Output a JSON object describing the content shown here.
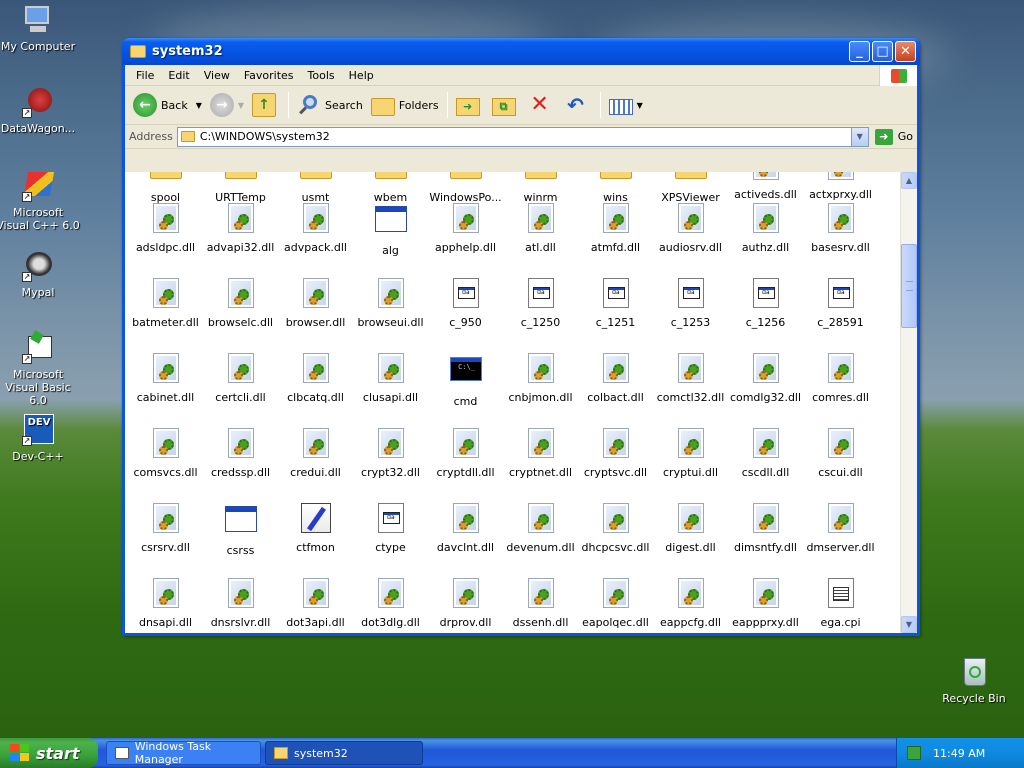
{
  "desktop": {
    "icons": [
      {
        "label": "My Computer",
        "icon": "computer-icon"
      },
      {
        "label": "DataWagon...",
        "icon": "datawagon-icon"
      },
      {
        "label": "Microsoft Visual C++ 6.0",
        "icon": "visual-cpp-icon"
      },
      {
        "label": "Mypal",
        "icon": "mypal-icon"
      },
      {
        "label": "Microsoft Visual Basic 6.0",
        "icon": "visual-basic-icon"
      },
      {
        "label": "Dev-C++",
        "icon": "devcpp-icon"
      },
      {
        "label": "Recycle Bin",
        "icon": "recycle-bin-icon"
      }
    ]
  },
  "window": {
    "title": "system32",
    "menu": [
      "File",
      "Edit",
      "View",
      "Favorites",
      "Tools",
      "Help"
    ],
    "toolbar": {
      "back_label": "Back",
      "search_label": "Search",
      "folders_label": "Folders"
    },
    "address": {
      "label": "Address",
      "value": "C:\\WINDOWS\\system32",
      "go_label": "Go"
    },
    "files": [
      {
        "name": "spool",
        "type": "folder"
      },
      {
        "name": "URTTemp",
        "type": "folder"
      },
      {
        "name": "usmt",
        "type": "folder"
      },
      {
        "name": "wbem",
        "type": "folder"
      },
      {
        "name": "WindowsPo...",
        "type": "folder"
      },
      {
        "name": "winrm",
        "type": "folder"
      },
      {
        "name": "wins",
        "type": "folder"
      },
      {
        "name": "XPSViewer",
        "type": "folder"
      },
      {
        "name": "activeds.dll",
        "type": "dll"
      },
      {
        "name": "actxprxy.dll",
        "type": "dll"
      },
      {
        "name": "adsldpc.dll",
        "type": "dll"
      },
      {
        "name": "advapi32.dll",
        "type": "dll"
      },
      {
        "name": "advpack.dll",
        "type": "dll"
      },
      {
        "name": "alg",
        "type": "exe"
      },
      {
        "name": "apphelp.dll",
        "type": "dll"
      },
      {
        "name": "atl.dll",
        "type": "dll"
      },
      {
        "name": "atmfd.dll",
        "type": "dll"
      },
      {
        "name": "audiosrv.dll",
        "type": "dll"
      },
      {
        "name": "authz.dll",
        "type": "dll"
      },
      {
        "name": "basesrv.dll",
        "type": "dll"
      },
      {
        "name": "batmeter.dll",
        "type": "dll"
      },
      {
        "name": "browselc.dll",
        "type": "dll"
      },
      {
        "name": "browser.dll",
        "type": "dll"
      },
      {
        "name": "browseui.dll",
        "type": "dll"
      },
      {
        "name": "c_950",
        "type": "nls"
      },
      {
        "name": "c_1250",
        "type": "nls"
      },
      {
        "name": "c_1251",
        "type": "nls"
      },
      {
        "name": "c_1253",
        "type": "nls"
      },
      {
        "name": "c_1256",
        "type": "nls"
      },
      {
        "name": "c_28591",
        "type": "nls"
      },
      {
        "name": "cabinet.dll",
        "type": "dll"
      },
      {
        "name": "certcli.dll",
        "type": "dll"
      },
      {
        "name": "clbcatq.dll",
        "type": "dll"
      },
      {
        "name": "clusapi.dll",
        "type": "dll"
      },
      {
        "name": "cmd",
        "type": "cmd"
      },
      {
        "name": "cnbjmon.dll",
        "type": "dll"
      },
      {
        "name": "colbact.dll",
        "type": "dll"
      },
      {
        "name": "comctl32.dll",
        "type": "dll"
      },
      {
        "name": "comdlg32.dll",
        "type": "dll"
      },
      {
        "name": "comres.dll",
        "type": "dll"
      },
      {
        "name": "comsvcs.dll",
        "type": "dll"
      },
      {
        "name": "credssp.dll",
        "type": "dll"
      },
      {
        "name": "credui.dll",
        "type": "dll"
      },
      {
        "name": "crypt32.dll",
        "type": "dll"
      },
      {
        "name": "cryptdll.dll",
        "type": "dll"
      },
      {
        "name": "cryptnet.dll",
        "type": "dll"
      },
      {
        "name": "cryptsvc.dll",
        "type": "dll"
      },
      {
        "name": "cryptui.dll",
        "type": "dll"
      },
      {
        "name": "cscdll.dll",
        "type": "dll"
      },
      {
        "name": "cscui.dll",
        "type": "dll"
      },
      {
        "name": "csrsrv.dll",
        "type": "dll"
      },
      {
        "name": "csrss",
        "type": "exe"
      },
      {
        "name": "ctfmon",
        "type": "edit"
      },
      {
        "name": "ctype",
        "type": "nls"
      },
      {
        "name": "davclnt.dll",
        "type": "dll"
      },
      {
        "name": "devenum.dll",
        "type": "dll"
      },
      {
        "name": "dhcpcsvc.dll",
        "type": "dll"
      },
      {
        "name": "digest.dll",
        "type": "dll"
      },
      {
        "name": "dimsntfy.dll",
        "type": "dll"
      },
      {
        "name": "dmserver.dll",
        "type": "dll"
      },
      {
        "name": "dnsapi.dll",
        "type": "dll"
      },
      {
        "name": "dnsrslvr.dll",
        "type": "dll"
      },
      {
        "name": "dot3api.dll",
        "type": "dll"
      },
      {
        "name": "dot3dlg.dll",
        "type": "dll"
      },
      {
        "name": "drprov.dll",
        "type": "dll"
      },
      {
        "name": "dssenh.dll",
        "type": "dll"
      },
      {
        "name": "eapolqec.dll",
        "type": "dll"
      },
      {
        "name": "eappcfg.dll",
        "type": "dll"
      },
      {
        "name": "eappprxy.dll",
        "type": "dll"
      },
      {
        "name": "ega.cpi",
        "type": "cpi"
      }
    ]
  },
  "taskbar": {
    "start_label": "start",
    "tasks": [
      {
        "label": "Windows Task Manager",
        "active": false
      },
      {
        "label": "system32",
        "active": true
      }
    ],
    "clock": "11:49 AM"
  }
}
